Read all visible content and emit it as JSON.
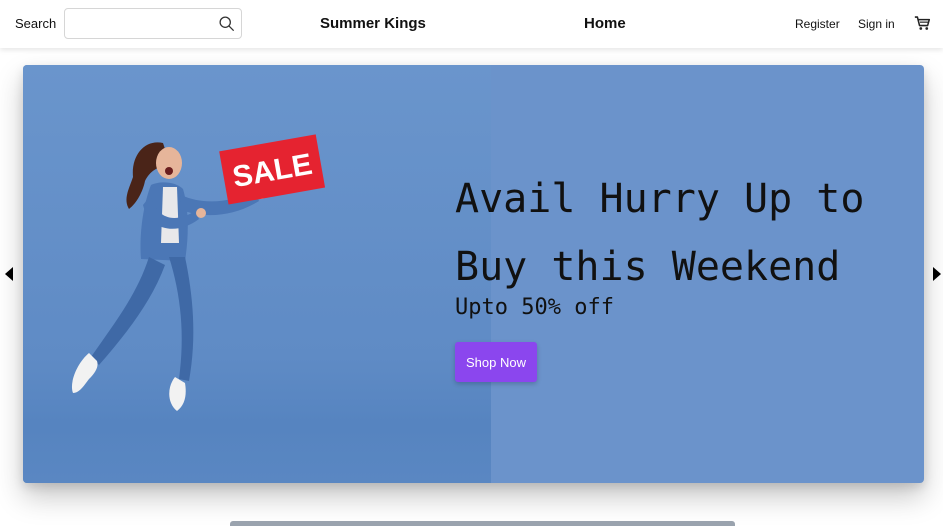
{
  "header": {
    "search_label": "Search",
    "search_value": "",
    "search_placeholder": "",
    "brand": "Summer Kings",
    "nav_home": "Home",
    "register": "Register",
    "sign_in": "Sign in",
    "cart_icon": "cart-icon",
    "search_icon": "search-icon"
  },
  "hero": {
    "sale_sign": "SALE",
    "headline_line1": "Avail Hurry Up to",
    "headline_line2": "Buy this Weekend",
    "subtext": "Upto 50% off",
    "cta_label": "Shop Now",
    "cta_color": "#8b46ee",
    "background_color": "#6b93cb"
  },
  "carousel": {
    "prev_icon": "caret-left-icon",
    "next_icon": "caret-right-icon"
  }
}
